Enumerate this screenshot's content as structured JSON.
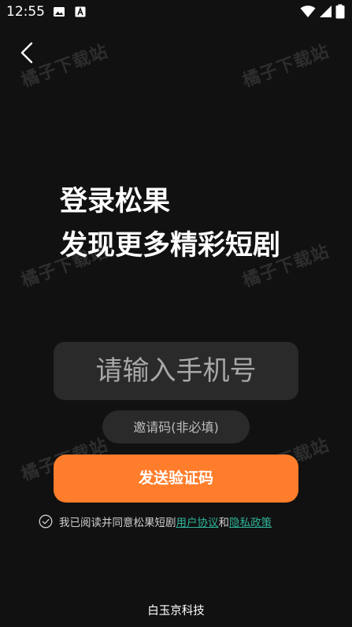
{
  "status_bar": {
    "time": "12:55",
    "icons": [
      "photo-icon",
      "a-letter-icon",
      "wifi-icon",
      "signal-icon",
      "battery-icon"
    ]
  },
  "back": {
    "icon": "chevron-left-icon"
  },
  "watermark": {
    "text": "橘子下载站"
  },
  "headline": {
    "line1": "登录松果",
    "line2": "发现更多精彩短剧"
  },
  "phone_input": {
    "placeholder": "请输入手机号",
    "value": ""
  },
  "invite_input": {
    "placeholder": "邀请码(非必填)",
    "value": ""
  },
  "send_button": {
    "label": "发送验证码",
    "color": "#ff7d2b"
  },
  "agreement": {
    "prefix": "我已阅读并同意松果短剧",
    "user_agreement": "用户协议",
    "conjunction": "和",
    "privacy_policy": "隐私政策",
    "link_color": "#2fb39a",
    "checked": false
  },
  "footer": {
    "company": "白玉京科技"
  },
  "colors": {
    "background": "#111111",
    "input_bg": "#2a2a2a",
    "accent": "#ff7d2b"
  }
}
